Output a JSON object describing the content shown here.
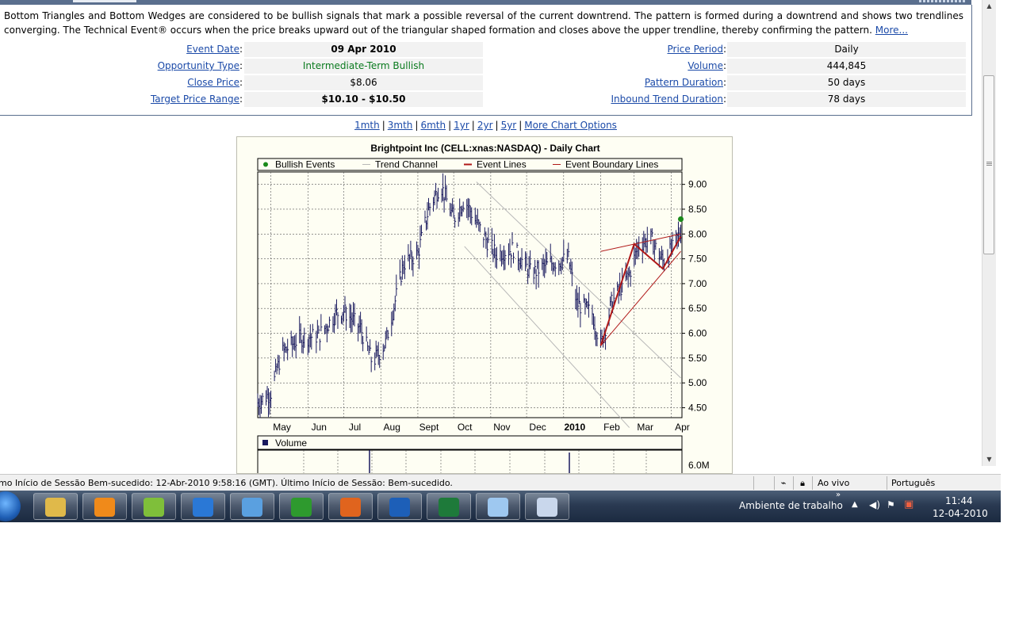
{
  "description": {
    "text": "Bottom Triangles and Bottom Wedges are considered to be bullish signals that mark a possible reversal of the current downtrend. The pattern is formed during a downtrend and shows two trendlines converging. The Technical Event® occurs when the price breaks upward out of the triangular shaped formation and closes above the upper trendline, thereby confirming the pattern.",
    "more_link": "More..."
  },
  "details_left": [
    {
      "label": "Event Date",
      "value": "09 Apr 2010"
    },
    {
      "label": "Opportunity Type",
      "value": "Intermediate-Term Bullish"
    },
    {
      "label": "Close Price",
      "value": "$8.06"
    },
    {
      "label": "Target Price Range",
      "value": "$10.10 - $10.50"
    }
  ],
  "details_right": [
    {
      "label": "Price Period",
      "value": "Daily"
    },
    {
      "label": "Volume",
      "value": "444,845"
    },
    {
      "label": "Pattern Duration",
      "value": "50 days"
    },
    {
      "label": "Inbound Trend Duration",
      "value": "78 days"
    }
  ],
  "chart_links": [
    "1mth",
    "3mth",
    "6mth",
    "1yr",
    "2yr",
    "5yr",
    "More Chart Options"
  ],
  "colors": {
    "bars": "#1a1a5e",
    "event_lines": "#b01818",
    "trend_channel": "#b8b8b8",
    "bullish_event": "#1a8a1a",
    "chart_bg": "#fefef3"
  },
  "chart_data": {
    "type": "ohlc",
    "title": "Brightpoint Inc (CELL:xnas:NASDAQ) - Daily Chart",
    "legend": [
      {
        "label": "Bullish Events",
        "marker": "dot"
      },
      {
        "label": "Trend Channel",
        "marker": "line"
      },
      {
        "label": "Event Lines",
        "marker": "line"
      },
      {
        "label": "Event Boundary Lines",
        "marker": "line"
      }
    ],
    "y_ticks": [
      "9.00",
      "8.50",
      "8.00",
      "7.50",
      "7.00",
      "6.50",
      "6.00",
      "5.50",
      "5.00",
      "4.50"
    ],
    "ylim": [
      4.3,
      9.25
    ],
    "x_labels": [
      "May",
      "Jun",
      "Jul",
      "Aug",
      "Sept",
      "Oct",
      "Nov",
      "Dec",
      "2010",
      "Feb",
      "Mar",
      "Apr"
    ],
    "x_bold": "2010",
    "close_path": [
      [
        "2009-04-20",
        4.6
      ],
      [
        "2009-05-01",
        4.8
      ],
      [
        "2009-05-10",
        5.6
      ],
      [
        "2009-05-25",
        5.9
      ],
      [
        "2009-06-10",
        5.95
      ],
      [
        "2009-06-25",
        6.4
      ],
      [
        "2009-07-01",
        6.45
      ],
      [
        "2009-07-15",
        6.1
      ],
      [
        "2009-07-25",
        5.4
      ],
      [
        "2009-08-05",
        5.8
      ],
      [
        "2009-08-20",
        7.4
      ],
      [
        "2009-09-01",
        7.6
      ],
      [
        "2009-09-10",
        8.5
      ],
      [
        "2009-09-20",
        9.0
      ],
      [
        "2009-10-01",
        8.3
      ],
      [
        "2009-10-10",
        8.7
      ],
      [
        "2009-10-25",
        8.0
      ],
      [
        "2009-11-05",
        7.6
      ],
      [
        "2009-11-20",
        7.7
      ],
      [
        "2009-12-05",
        7.2
      ],
      [
        "2009-12-20",
        7.4
      ],
      [
        "2010-01-05",
        7.5
      ],
      [
        "2010-01-12",
        6.6
      ],
      [
        "2010-01-25",
        6.4
      ],
      [
        "2010-02-01",
        5.75
      ],
      [
        "2010-02-10",
        6.6
      ],
      [
        "2010-02-25",
        7.2
      ],
      [
        "2010-03-05",
        7.8
      ],
      [
        "2010-03-15",
        7.9
      ],
      [
        "2010-03-25",
        7.45
      ],
      [
        "2010-04-02",
        7.7
      ],
      [
        "2010-04-09",
        8.06
      ]
    ],
    "bullish_event": {
      "x": "2010-04-09",
      "y": 8.3
    },
    "event_lines": [
      [
        [
          "2010-02-01",
          5.75
        ],
        [
          "2010-03-01",
          7.8
        ],
        [
          "2010-03-25",
          7.3
        ],
        [
          "2010-04-09",
          7.95
        ]
      ]
    ],
    "event_boundary_lines": [
      [
        [
          "2010-02-01",
          5.75
        ],
        [
          "2010-04-09",
          7.65
        ]
      ],
      [
        [
          "2010-02-01",
          7.65
        ],
        [
          "2010-04-09",
          8.0
        ]
      ]
    ],
    "trend_channel": [
      [
        [
          "2009-10-20",
          9.05
        ],
        [
          "2010-04-09",
          5.1
        ]
      ],
      [
        [
          "2009-10-10",
          7.75
        ],
        [
          "2010-02-25",
          4.1
        ]
      ]
    ],
    "volume_title": "Volume",
    "volume_tick": "6.0M"
  },
  "status": {
    "session_msg": "mo Início de Sessão Bem-sucedido: 12-Abr-2010 9:58:16 (GMT). Último Início de Sessão: Bem-sucedido.",
    "mode": "Ao vivo",
    "language": "Português"
  },
  "taskbar": {
    "desktop_label": "Ambiente de trabalho",
    "time": "11:44",
    "date": "12-04-2010",
    "apps": [
      {
        "name": "windows-explorer",
        "color": "#e0b94a"
      },
      {
        "name": "media-player",
        "color": "#f08a1a"
      },
      {
        "name": "sticky-folders",
        "color": "#7fbf3a"
      },
      {
        "name": "internet-explorer",
        "color": "#2a78d6"
      },
      {
        "name": "messenger",
        "color": "#5aa0e0"
      },
      {
        "name": "utorrent",
        "color": "#2e9a2e"
      },
      {
        "name": "firefox",
        "color": "#e0641e"
      },
      {
        "name": "b-app",
        "color": "#1d5fb8"
      },
      {
        "name": "excel",
        "color": "#1e7a3a"
      },
      {
        "name": "paint",
        "color": "#9ec8f0"
      },
      {
        "name": "pen-app",
        "color": "#c9d7ec"
      }
    ]
  }
}
